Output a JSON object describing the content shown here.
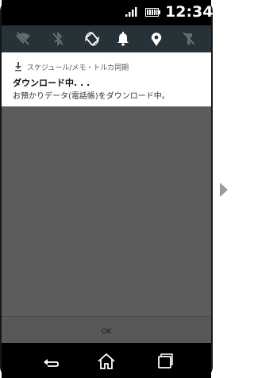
{
  "status_bar": {
    "time": "12:34",
    "icons": [
      "signal-icon",
      "battery-icon"
    ]
  },
  "quick_settings": {
    "icons": [
      "wifi-off-icon",
      "bluetooth-off-icon",
      "auto-rotate-icon",
      "bell-icon",
      "location-icon",
      "flashlight-off-icon"
    ]
  },
  "notification": {
    "icon": "download-icon",
    "app_name": "スケジュール/メモ・トルカ同期",
    "title": "ダウンロード中. . .",
    "body": "お預かりデータ(電話帳)をダウンロード中。"
  },
  "dialog": {
    "ok_label": "OK"
  },
  "nav_bar": {
    "icons": [
      "back-icon",
      "home-icon",
      "recents-icon"
    ]
  },
  "colors": {
    "quick_settings_bg": "#263238",
    "dim_overlay": "#5c5c5c",
    "notification_bg": "#ffffff"
  }
}
